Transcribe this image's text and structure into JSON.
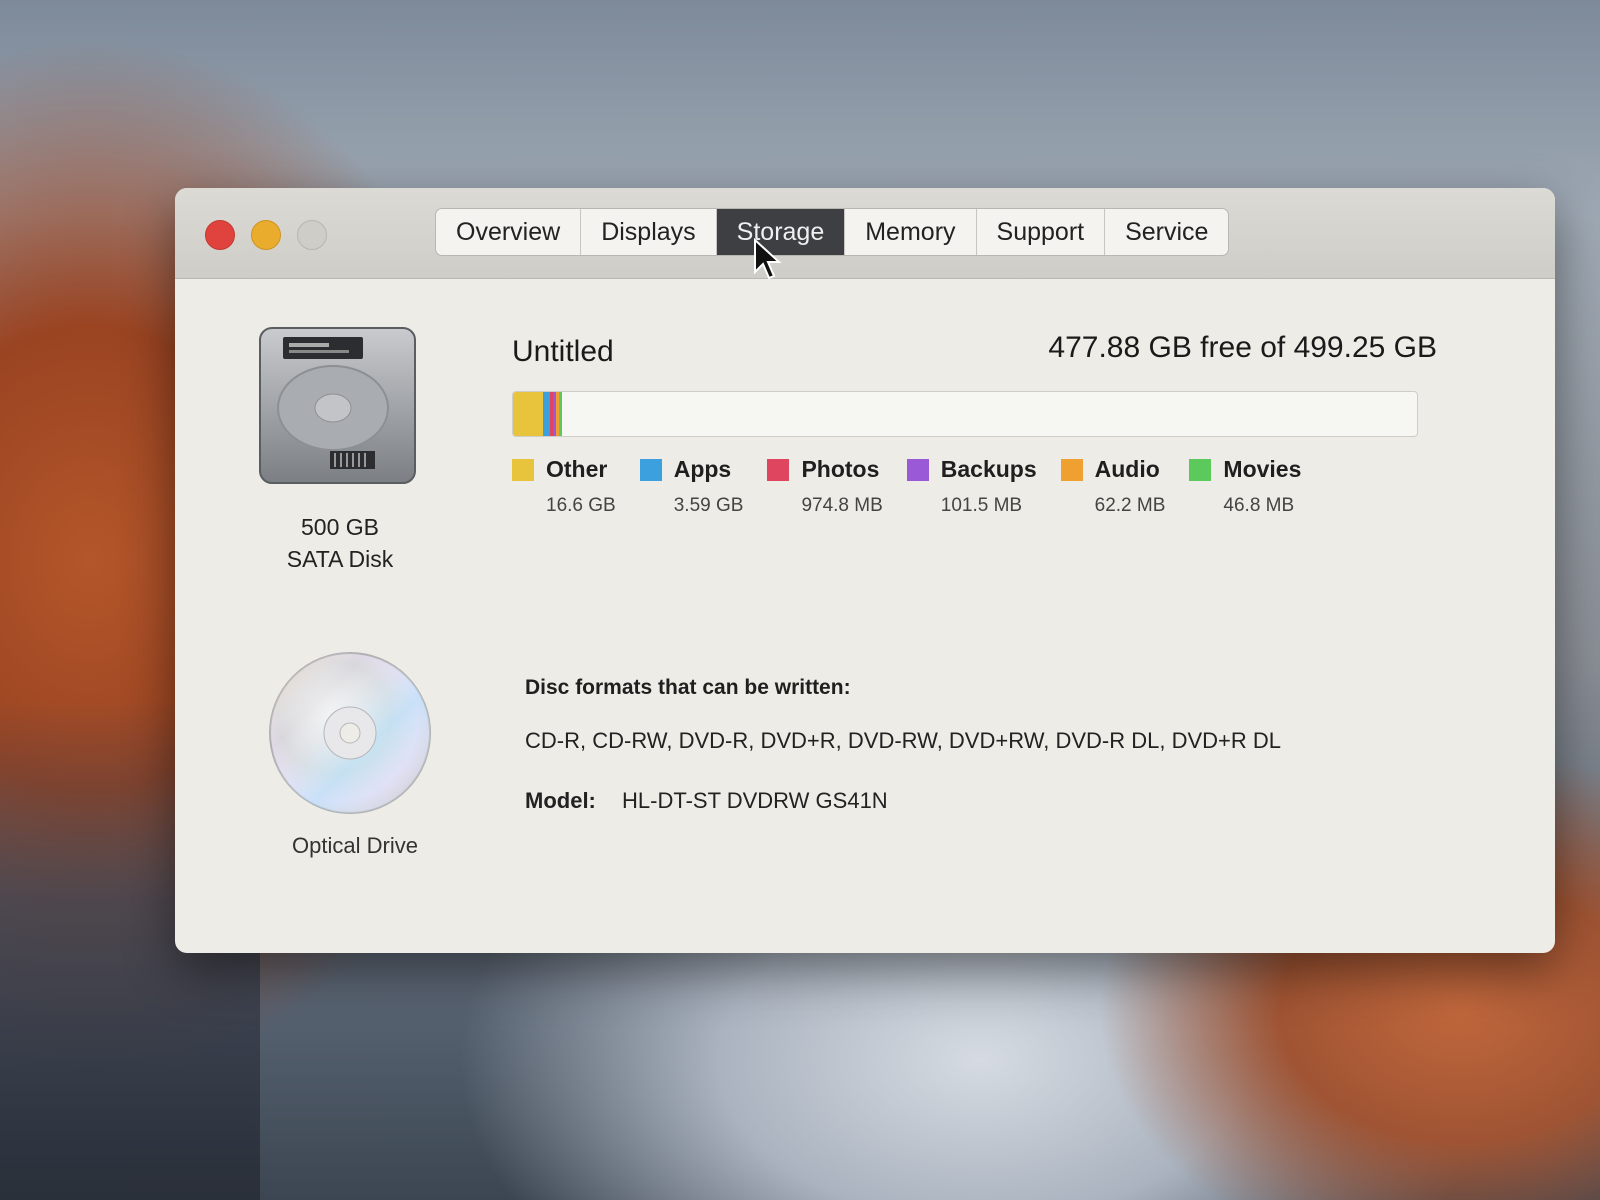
{
  "window": {
    "tabs": [
      {
        "label": "Overview"
      },
      {
        "label": "Displays"
      },
      {
        "label": "Storage"
      },
      {
        "label": "Memory"
      },
      {
        "label": "Support"
      },
      {
        "label": "Service"
      }
    ],
    "active_tab": "Storage"
  },
  "disk": {
    "capacity": "500 GB",
    "type": "SATA Disk",
    "volume_name": "Untitled",
    "free_text": "477.88 GB free of 499.25 GB",
    "total_gb": 499.25,
    "free_gb": 477.88,
    "categories": [
      {
        "label": "Other",
        "size": "16.6 GB",
        "size_gb": 16.6,
        "color": "#e7c43b"
      },
      {
        "label": "Apps",
        "size": "3.59 GB",
        "size_gb": 3.59,
        "color": "#3ba0dd"
      },
      {
        "label": "Photos",
        "size": "974.8 MB",
        "size_gb": 0.9748,
        "color": "#e04560"
      },
      {
        "label": "Backups",
        "size": "101.5 MB",
        "size_gb": 0.1015,
        "color": "#9a5ad8"
      },
      {
        "label": "Audio",
        "size": "62.2 MB",
        "size_gb": 0.0622,
        "color": "#f0a031"
      },
      {
        "label": "Movies",
        "size": "46.8 MB",
        "size_gb": 0.0468,
        "color": "#5cc95c"
      }
    ]
  },
  "optical": {
    "caption": "Optical Drive",
    "formats_heading": "Disc formats that can be written:",
    "formats": "CD-R, CD-RW, DVD-R, DVD+R, DVD-RW, DVD+RW, DVD-R DL, DVD+R DL",
    "model_label": "Model:",
    "model_value": "HL-DT-ST DVDRW GS41N"
  },
  "icons": {
    "close": "close-button-icon",
    "minimize": "minimize-button-icon",
    "zoom": "zoom-button-icon",
    "hard_disk": "hard-disk-icon",
    "optical_disc": "optical-disc-icon",
    "cursor": "mouse-pointer-icon"
  }
}
